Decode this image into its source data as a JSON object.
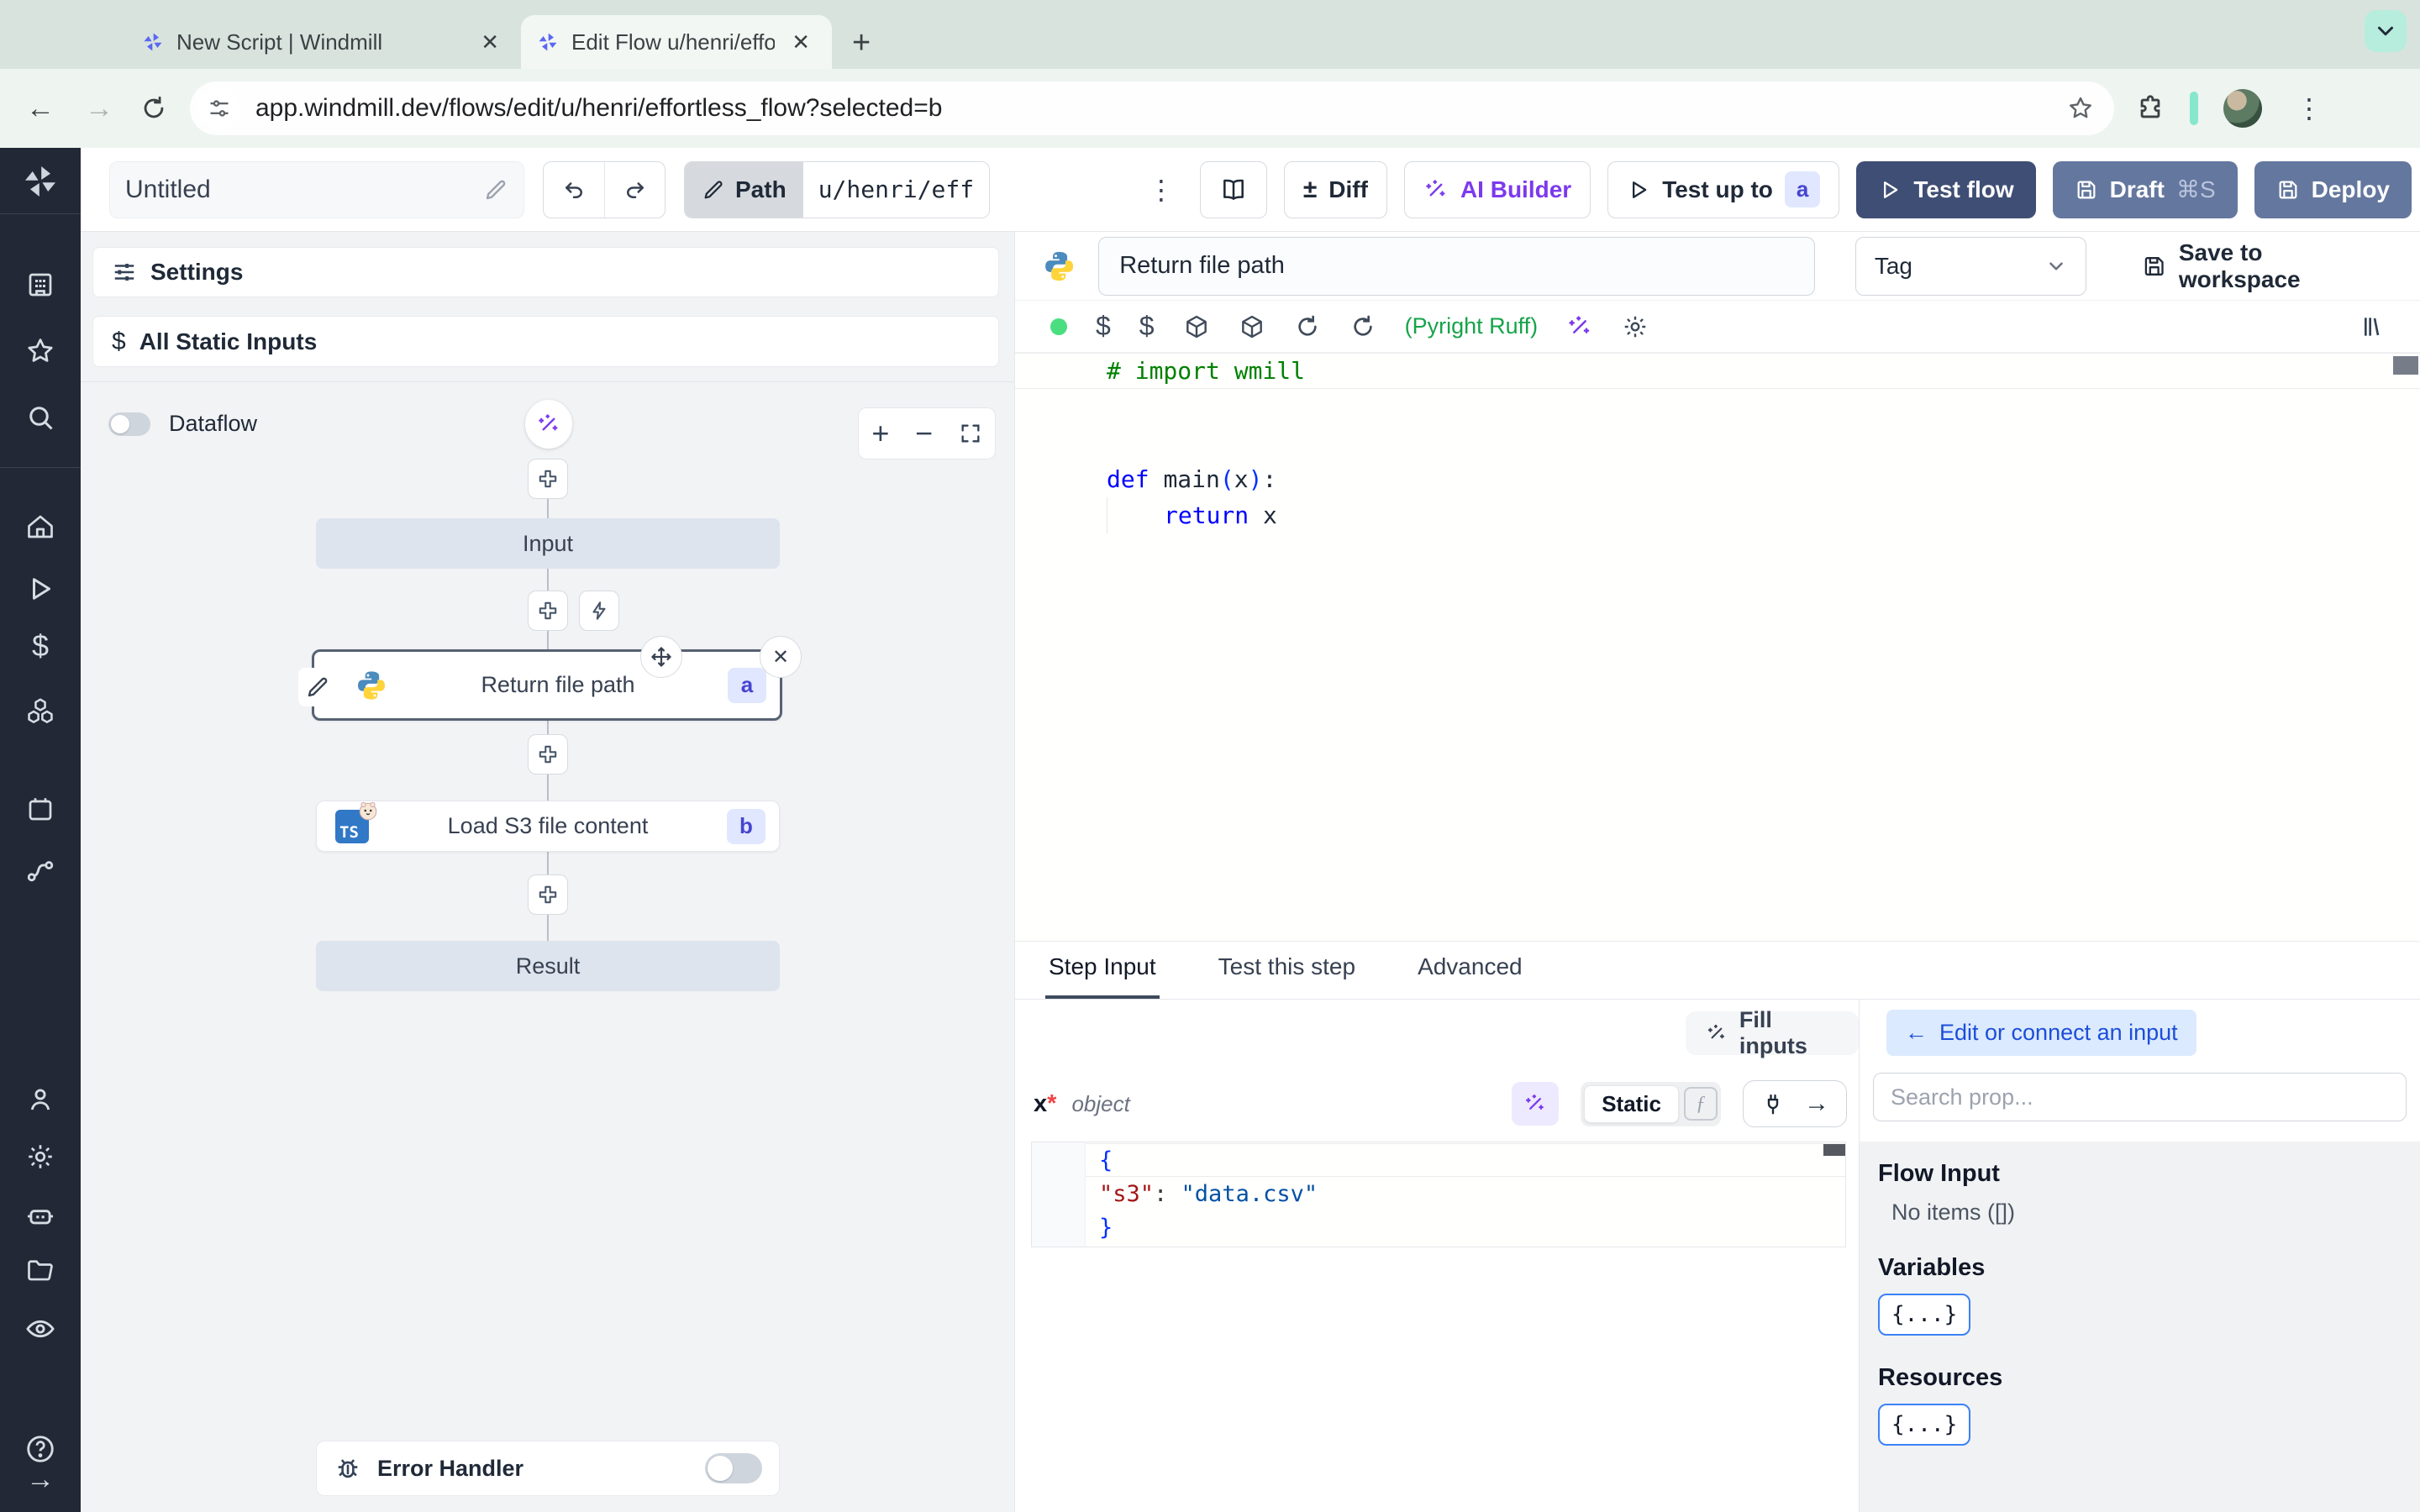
{
  "browser": {
    "tabs": [
      {
        "title": "New Script | Windmill"
      },
      {
        "title": "Edit Flow u/henri/effortless_fl"
      }
    ],
    "url": "app.windmill.dev/flows/edit/u/henri/effortless_flow?selected=b"
  },
  "glyphs": {
    "kebab": "⋮",
    "back": "←",
    "forward": "→",
    "close": "✕",
    "plus": "+",
    "minus": "−",
    "plus_minus": "±",
    "arrow_left": "←",
    "arrow_right": "→",
    "new_tab": "+"
  },
  "toolbar": {
    "flow_name": "Untitled",
    "path_label": "Path",
    "path_value": "u/henri/eff",
    "diff_label": "Diff",
    "ai_builder_label": "AI Builder",
    "test_up_to_label": "Test up to",
    "test_up_to_badge": "a",
    "test_flow_label": "Test flow",
    "draft_label": "Draft",
    "draft_shortcut": "⌘S",
    "deploy_label": "Deploy"
  },
  "flow": {
    "settings_label": "Settings",
    "dollar": "$",
    "all_static_inputs_label": "All Static Inputs",
    "dataflow_label": "Dataflow",
    "input_node": "Input",
    "step_a_label": "Return file path",
    "step_a_badge": "a",
    "step_b_label": "Load S3 file content",
    "step_b_badge": "b",
    "ts_logo": "TS",
    "result_node": "Result",
    "error_handler_label": "Error Handler"
  },
  "editor": {
    "step_name": "Return file path",
    "tag_label": "Tag",
    "save_label": "Save to workspace",
    "lint_label": "(Pyright Ruff)",
    "code": {
      "comment": "# import wmill",
      "kw_def": "def ",
      "fn_name": "main",
      "paren_open": "(",
      "arg": "x",
      "paren_close": ")",
      "colon": ":",
      "kw_return": "return ",
      "return_arg": "x"
    }
  },
  "panel_tabs": {
    "step_input": "Step Input",
    "test_step": "Test this step",
    "advanced": "Advanced"
  },
  "step_input": {
    "fill_inputs_label": "Fill inputs",
    "arg_name": "x",
    "arg_required": "*",
    "arg_type": "object",
    "static_label": "Static",
    "fx_label": "ƒ",
    "json": {
      "open_brace": "{",
      "key": "\"s3\"",
      "colon": ": ",
      "value": "\"data.csv\"",
      "close_brace": "}"
    }
  },
  "connect": {
    "edit_button": "Edit or connect an input",
    "search_placeholder": "Search prop...",
    "flow_input_title": "Flow Input",
    "flow_input_empty": "No items ([])",
    "variables_title": "Variables",
    "resources_title": "Resources",
    "object_button": "{...}"
  },
  "colors": {
    "accent_purple": "#7c3aed",
    "test_flow_bg": "#3f4e74",
    "draft_deploy_bg": "#64779e",
    "badge_bg": "#e0e7ff",
    "badge_text": "#4745d0",
    "lint_green": "#16a34a",
    "edit_btn_bg": "#dbeafe",
    "edit_btn_text": "#1d4ed8",
    "sidebar_bg": "#222836",
    "node_gray_bg": "#dde4ed",
    "canvas_bg": "#f2f3f5"
  }
}
